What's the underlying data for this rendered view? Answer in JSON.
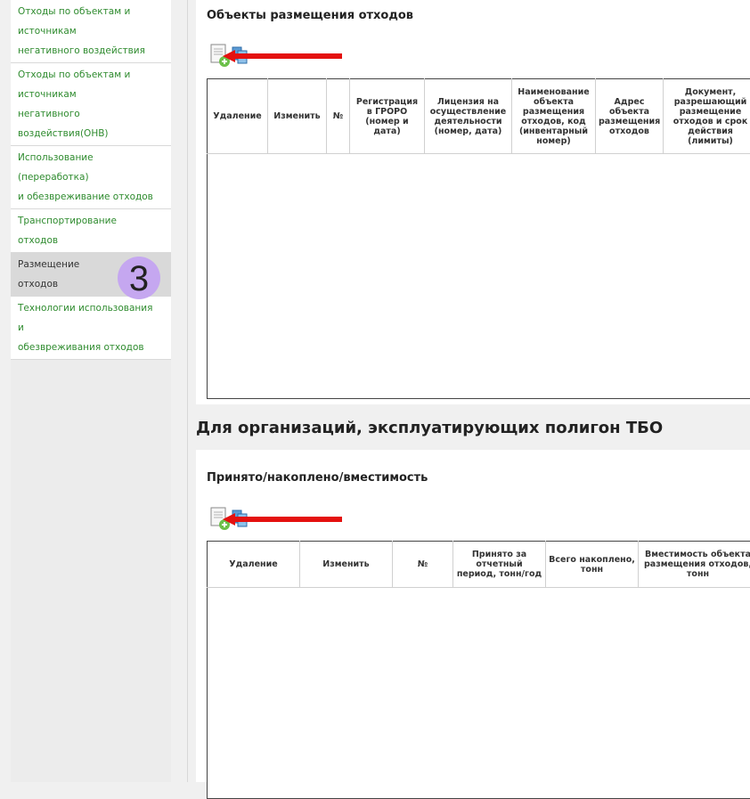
{
  "sidebar": {
    "items": [
      {
        "lines": [
          "Отходы по объектам и",
          "источникам",
          "негативного воздействия"
        ]
      },
      {
        "lines": [
          "Отходы по объектам и",
          "источникам",
          "негативного",
          "воздействия(ОНВ)"
        ]
      },
      {
        "lines": [
          "Использование",
          "(переработка)",
          "и обезвреживание отходов"
        ]
      },
      {
        "lines": [
          "Транспортирование",
          "отходов"
        ]
      },
      {
        "lines": [
          "Размещение",
          "отходов"
        ]
      },
      {
        "lines": [
          "Технологии использования",
          "и",
          "обезвреживания отходов"
        ]
      }
    ],
    "active_index": 4,
    "badge": "3"
  },
  "section1": {
    "title": "Объекты размещения отходов",
    "columns": [
      "Удаление",
      "Изменить",
      "№",
      "Регистрация в ГРОРО (номер и дата)",
      "Лицензия на осуществление деятельности (номер, дата)",
      "Наименование объекта размещения отходов, код (инвентарный номер)",
      "Адрес объекта размещения отходов",
      "Документ, разрешающий размещение отходов и срок действия (лимиты)"
    ]
  },
  "heading2": "Для организаций, эксплуатирующих полигон ТБО",
  "section2": {
    "title": "Принято/накоплено/вместимость",
    "columns": [
      "Удаление",
      "Изменить",
      "№",
      "Принято за отчетный период, тонн/год",
      "Всего накоплено, тонн",
      "Вместимость объекта размещения отходов, тонн"
    ]
  },
  "icons": {
    "add_doc": "add-document-icon",
    "arrow": "red-arrow-annotation"
  },
  "colors": {
    "link_green": "#2e8b2e",
    "arrow_red": "#e4110f",
    "badge_purple": "#c5a7f0"
  }
}
